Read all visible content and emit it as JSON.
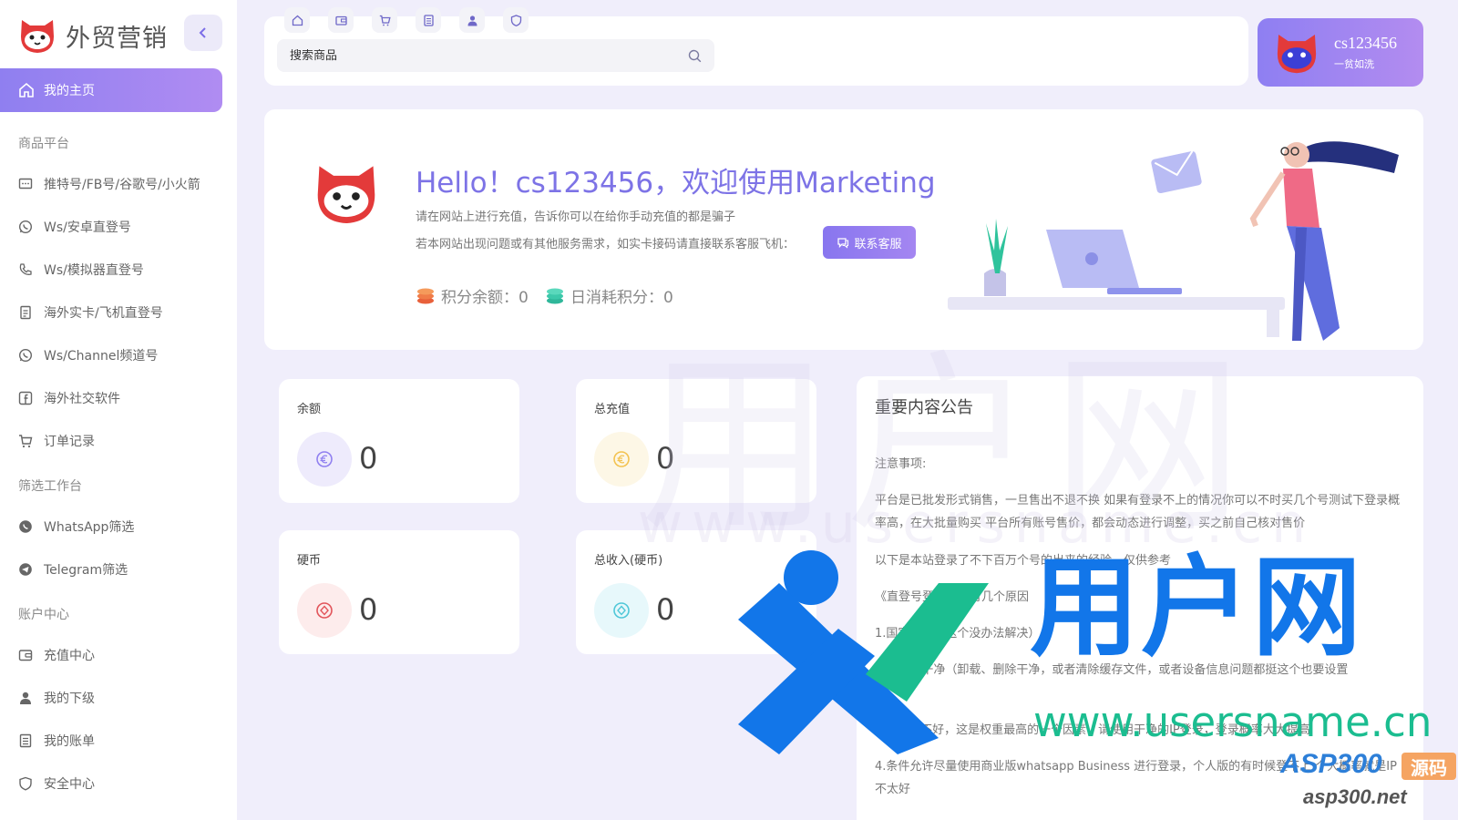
{
  "brand": {
    "title": "外贸营销"
  },
  "sidebar": {
    "home_label": "我的主页",
    "sections": [
      {
        "title": "商品平台"
      },
      {
        "title": "筛选工作台"
      },
      {
        "title": "账户中心"
      }
    ],
    "items": [
      {
        "label": "推特号/FB号/谷歌号/小火箭",
        "icon": "message-icon"
      },
      {
        "label": "Ws/安卓直登号",
        "icon": "whatsapp-icon"
      },
      {
        "label": "Ws/模拟器直登号",
        "icon": "phone-icon"
      },
      {
        "label": "海外实卡/飞机直登号",
        "icon": "document-icon"
      },
      {
        "label": "Ws/Channel频道号",
        "icon": "whatsapp-icon"
      },
      {
        "label": "海外社交软件",
        "icon": "facebook-icon"
      },
      {
        "label": "订单记录",
        "icon": "cart-icon"
      },
      {
        "label": "WhatsApp筛选",
        "icon": "whatsapp-filled-icon"
      },
      {
        "label": "Telegram筛选",
        "icon": "telegram-icon"
      },
      {
        "label": "充值中心",
        "icon": "wallet-icon"
      },
      {
        "label": "我的下级",
        "icon": "user-icon"
      },
      {
        "label": "我的账单",
        "icon": "bill-icon"
      },
      {
        "label": "安全中心",
        "icon": "shield-icon"
      }
    ]
  },
  "topbar": {
    "quick_icons": [
      "home-icon",
      "wallet-icon",
      "cart-icon",
      "bill-icon",
      "user-icon",
      "shield-icon"
    ],
    "search_placeholder": "搜索商品"
  },
  "user": {
    "name": "cs123456",
    "slogan": "一贫如洗"
  },
  "welcome": {
    "title": "Hello！cs123456，欢迎使用Marketing",
    "line1": "请在网站上进行充值，告诉你可以在给你手动充值的都是骗子",
    "line2": "若本网站出现问题或有其他服务需求，如实卡接码请直接联系客服飞机：",
    "contact_label": "联系客服",
    "points_balance": "积分余额：0",
    "daily_points": "日消耗积分：0"
  },
  "stats": [
    {
      "label": "余额",
      "value": "0",
      "color": "#8f7ff0",
      "icon": "euro-icon"
    },
    {
      "label": "总充值",
      "value": "0",
      "color": "#f3c24f",
      "icon": "euro-icon"
    },
    {
      "label": "硬币",
      "value": "0",
      "color": "#e2545a",
      "icon": "coin-icon"
    },
    {
      "label": "总收入(硬币)",
      "value": "0",
      "color": "#4fc7d8",
      "icon": "coin-icon"
    }
  ],
  "notice": {
    "title": "重要内容公告",
    "lines": [
      "注意事项:",
      "平台是已批发形式销售，一旦售出不退不换 如果有登录不上的情况你可以不时买几个号测试下登录概率高，在大批量购买 平台所有账号售价，都会动态进行调整，买之前自己核对售价",
      "以下是本站登录了不下百万个号的出来的经验，仅供参考",
      "《直登号登录不上有几个原因",
      "1.国家不对（这个没办法解决）",
      "2.环境不干净（卸载、删除干净，或者清除缓存文件，或者设备信息问题都挺这个也要设置",
      "3.登录IP不好，这是权重最高的一个因素，请使用干净的IP登录，登录概率大大提高",
      "4.条件允许尽量使用商业版whatsapp Business 进行登录，个人版的有时候登不上 个大概率就是IP不太好"
    ]
  },
  "watermark": {
    "big_text": "用户网",
    "url_text": "www.usersname.cn",
    "overlay_text": "用户网",
    "overlay_url": "www.usersname.cn",
    "asp_text": "ASP300",
    "asp_tag": "源码",
    "asp_url": "asp300.net"
  }
}
